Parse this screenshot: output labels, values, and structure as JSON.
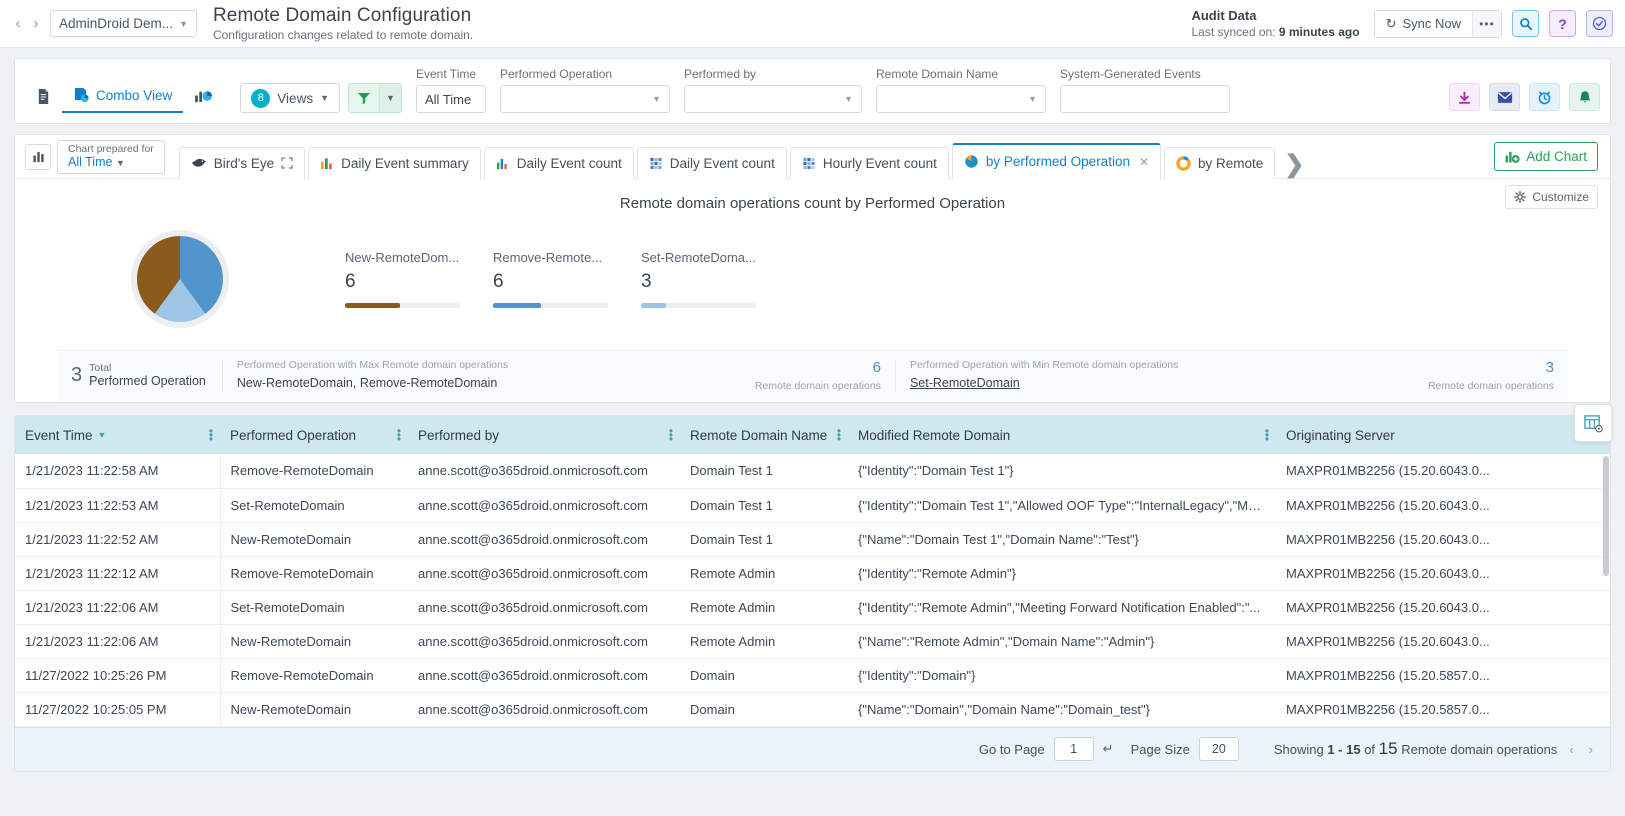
{
  "header": {
    "org_selector": "AdminDroid Dem...",
    "title": "Remote Domain Configuration",
    "subtitle": "Configuration changes related to remote domain.",
    "audit_title": "Audit Data",
    "audit_sync_prefix": "Last synced on:",
    "audit_sync_value": "9 minutes ago",
    "sync_now": "Sync Now",
    "more_dots": "•••"
  },
  "filterbar": {
    "combo_view": "Combo View",
    "views_label": "Views",
    "views_count": "8",
    "fields": [
      {
        "label": "Event Time",
        "value": "All Time",
        "placeholder": "",
        "width": "w-alltime",
        "dropdown": false
      },
      {
        "label": "Performed Operation",
        "value": "",
        "placeholder": "",
        "width": "w-op",
        "dropdown": true
      },
      {
        "label": "Performed by",
        "value": "",
        "placeholder": "",
        "width": "w-by",
        "dropdown": true
      },
      {
        "label": "Remote Domain Name",
        "value": "",
        "placeholder": "",
        "width": "w-dom",
        "dropdown": true
      },
      {
        "label": "System-Generated Events",
        "value": "",
        "placeholder": "",
        "width": "w-sys",
        "dropdown": false
      }
    ]
  },
  "chart_panel": {
    "prepared_for_label": "Chart prepared for",
    "prepared_for_value": "All Time",
    "tabs": [
      {
        "label": "Bird's Eye",
        "icon": "birds-eye-icon",
        "active": false,
        "closable": false
      },
      {
        "label": "Daily Event summary",
        "icon": "bar-chart-icon",
        "active": false,
        "closable": false
      },
      {
        "label": "Daily Event count",
        "icon": "bar-chart-icon",
        "active": false,
        "closable": false
      },
      {
        "label": "Daily Event count",
        "icon": "heatmap-icon",
        "active": false,
        "closable": false
      },
      {
        "label": "Hourly Event count",
        "icon": "heatmap-icon",
        "active": false,
        "closable": false
      },
      {
        "label": "by Performed Operation",
        "icon": "pie-chart-icon",
        "active": true,
        "closable": true
      },
      {
        "label": "by Remote",
        "icon": "donut-chart-icon",
        "active": false,
        "closable": false
      }
    ],
    "add_chart": "Add Chart",
    "customize": "Customize"
  },
  "chart_data": {
    "type": "pie",
    "title": "Remote domain operations count by Performed Operation",
    "categories": [
      "New-RemoteDom...",
      "Remove-Remote...",
      "Set-RemoteDoma..."
    ],
    "full_categories": [
      "New-RemoteDomain",
      "Remove-RemoteDomain",
      "Set-RemoteDomain"
    ],
    "values": [
      6,
      6,
      3
    ],
    "colors": [
      "#8b5a1d",
      "#5295cd",
      "#9dc6e6"
    ],
    "bar_fracs": [
      0.48,
      0.42,
      0.22
    ],
    "total_slices": 3,
    "legend_position": "right"
  },
  "chart_stats": {
    "total_value": "3",
    "total_label_1": "Total",
    "total_label_2": "Performed Operation",
    "max_caption": "Performed Operation with Max Remote domain operations",
    "max_value_name": "New-RemoteDomain, Remove-RemoteDomain",
    "max_count": "6",
    "max_count_label": "Remote domain operations",
    "min_caption": "Performed Operation with Min Remote domain operations",
    "min_value_name": "Set-RemoteDomain",
    "min_count": "3",
    "min_count_label": "Remote domain operations"
  },
  "table": {
    "columns": [
      {
        "label": "Event Time",
        "sortable": true
      },
      {
        "label": "Performed Operation",
        "sortable": false
      },
      {
        "label": "Performed by",
        "sortable": false
      },
      {
        "label": "Remote Domain Name",
        "sortable": false
      },
      {
        "label": "Modified Remote Domain",
        "sortable": false
      },
      {
        "label": "Originating Server",
        "sortable": false
      }
    ],
    "rows": [
      {
        "event_time": "1/21/2023 11:22:58 AM",
        "performed_operation": "Remove-RemoteDomain",
        "performed_by": "anne.scott@o365droid.onmicrosoft.com",
        "remote_domain_name": "Domain Test 1",
        "modified_remote_domain": "{\"Identity\":\"Domain Test 1\"}",
        "originating_server": "MAXPR01MB2256 (15.20.6043.0..."
      },
      {
        "event_time": "1/21/2023 11:22:53 AM",
        "performed_operation": "Set-RemoteDomain",
        "performed_by": "anne.scott@o365droid.onmicrosoft.com",
        "remote_domain_name": "Domain Test 1",
        "modified_remote_domain": "{\"Identity\":\"Domain Test 1\",\"Allowed OOF Type\":\"InternalLegacy\",\"Me...",
        "originating_server": "MAXPR01MB2256 (15.20.6043.0..."
      },
      {
        "event_time": "1/21/2023 11:22:52 AM",
        "performed_operation": "New-RemoteDomain",
        "performed_by": "anne.scott@o365droid.onmicrosoft.com",
        "remote_domain_name": "Domain Test 1",
        "modified_remote_domain": "{\"Name\":\"Domain Test 1\",\"Domain Name\":\"Test\"}",
        "originating_server": "MAXPR01MB2256 (15.20.6043.0..."
      },
      {
        "event_time": "1/21/2023 11:22:12 AM",
        "performed_operation": "Remove-RemoteDomain",
        "performed_by": "anne.scott@o365droid.onmicrosoft.com",
        "remote_domain_name": "Remote Admin",
        "modified_remote_domain": "{\"Identity\":\"Remote Admin\"}",
        "originating_server": "MAXPR01MB2256 (15.20.6043.0..."
      },
      {
        "event_time": "1/21/2023 11:22:06 AM",
        "performed_operation": "Set-RemoteDomain",
        "performed_by": "anne.scott@o365droid.onmicrosoft.com",
        "remote_domain_name": "Remote Admin",
        "modified_remote_domain": "{\"Identity\":\"Remote Admin\",\"Meeting Forward Notification Enabled\":\"...",
        "originating_server": "MAXPR01MB2256 (15.20.6043.0..."
      },
      {
        "event_time": "1/21/2023 11:22:06 AM",
        "performed_operation": "New-RemoteDomain",
        "performed_by": "anne.scott@o365droid.onmicrosoft.com",
        "remote_domain_name": "Remote Admin",
        "modified_remote_domain": "{\"Name\":\"Remote Admin\",\"Domain Name\":\"Admin\"}",
        "originating_server": "MAXPR01MB2256 (15.20.6043.0..."
      },
      {
        "event_time": "11/27/2022 10:25:26 PM",
        "performed_operation": "Remove-RemoteDomain",
        "performed_by": "anne.scott@o365droid.onmicrosoft.com",
        "remote_domain_name": "Domain",
        "modified_remote_domain": "{\"Identity\":\"Domain\"}",
        "originating_server": "MAXPR01MB2256 (15.20.5857.0..."
      },
      {
        "event_time": "11/27/2022 10:25:05 PM",
        "performed_operation": "New-RemoteDomain",
        "performed_by": "anne.scott@o365droid.onmicrosoft.com",
        "remote_domain_name": "Domain",
        "modified_remote_domain": "{\"Name\":\"Domain\",\"Domain Name\":\"Domain_test\"}",
        "originating_server": "MAXPR01MB2256 (15.20.5857.0..."
      }
    ],
    "footer": {
      "go_to_page_label": "Go to Page",
      "go_to_page_value": "1",
      "page_size_label": "Page Size",
      "page_size_value": "20",
      "showing_prefix": "Showing",
      "showing_range": "1 - 15",
      "showing_of": "of",
      "showing_total": "15",
      "showing_suffix": "Remote domain operations",
      "prev_arrow": "‹",
      "next_arrow": "›"
    }
  }
}
